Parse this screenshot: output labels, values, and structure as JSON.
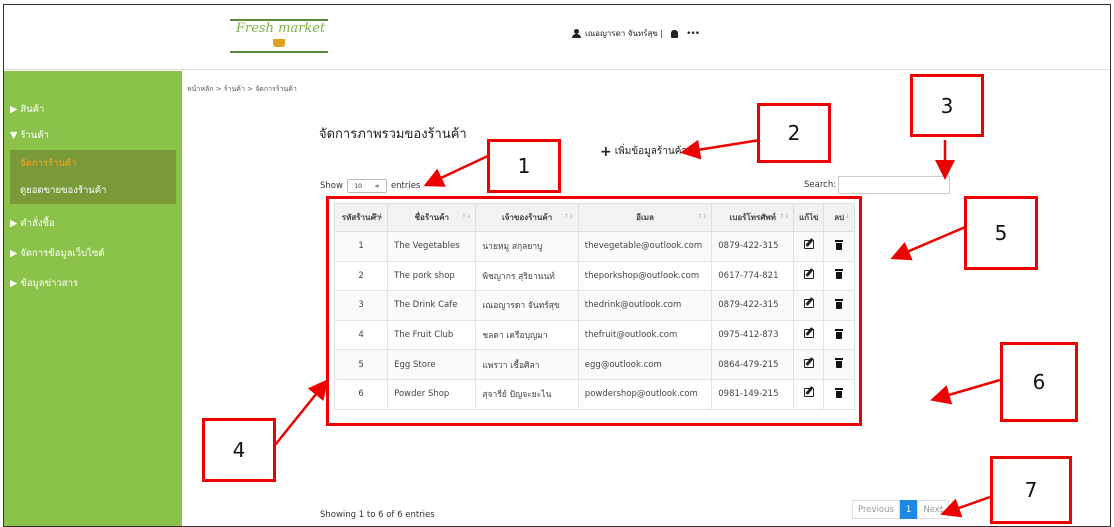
{
  "header": {
    "logo_text": "Fresh market",
    "user_name": "เณอญารดา จันทร์สุข |",
    "more": "•••"
  },
  "sidebar": {
    "items": [
      {
        "label": "▶ สินค้า"
      },
      {
        "label": "▼ ร้านค้า"
      },
      {
        "label": "จัดการร้านค้า"
      },
      {
        "label": "ดูยอดขายของร้านค้า"
      },
      {
        "label": "▶ คำสั่งซื้อ"
      },
      {
        "label": "▶ จัดการข้อมูลเว็บไซต์"
      },
      {
        "label": "▶ ข้อมูลข่าวสาร"
      }
    ]
  },
  "breadcrumb": "หน้าหลัก > ร้านค้า > จัดการร้านค้า",
  "page_title": "จัดการภาพรวมของร้านค้า",
  "add_button": {
    "plus": "+",
    "label": "เพิ่มข้อมูลร้านค้า"
  },
  "show": {
    "prefix": "Show",
    "value": "10",
    "arrows": "≑",
    "suffix": "entries"
  },
  "search": {
    "label": "Search:"
  },
  "table": {
    "headers": [
      "รหัสร้านค้า",
      "ชื่อร้านค้า",
      "เจ้าของร้านค้า",
      "อีเมล",
      "เบอร์โทรศัพท์",
      "แก้ไข",
      "ลบ"
    ],
    "sort_asc": "↑↓",
    "rows": [
      {
        "id": "1",
        "name": "The Vegetables",
        "owner": "นายหมู สกุลยาบู",
        "email": "thevegetable@outlook.com",
        "phone": "0879-422-315"
      },
      {
        "id": "2",
        "name": "The pork shop",
        "owner": "พิชญากร สุริยานนท์",
        "email": "theporkshop@outlook.com",
        "phone": "0617-774-821"
      },
      {
        "id": "3",
        "name": "The Drink Cafe",
        "owner": "เณอญารดา จันทร์สุข",
        "email": "thedrink@outlook.com",
        "phone": "0879-422-315"
      },
      {
        "id": "4",
        "name": "The Fruit Club",
        "owner": "ชลดา เครือบุญมา",
        "email": "thefruit@outlook.com",
        "phone": "0975-412-873"
      },
      {
        "id": "5",
        "name": "Egg Store",
        "owner": "แพรวา เชื้อศิลา",
        "email": "egg@outlook.com",
        "phone": "0864-479-215"
      },
      {
        "id": "6",
        "name": "Powder Shop",
        "owner": "สุจารีย์ ปัญจะยะไน",
        "email": "powdershop@outlook.com",
        "phone": "0981-149-215"
      }
    ]
  },
  "footer": {
    "showing": "Showing 1 to 6 of 6 entries",
    "prev": "Previous",
    "page": "1",
    "next": "Next"
  },
  "annotations": [
    "1",
    "2",
    "3",
    "4",
    "5",
    "6",
    "7"
  ],
  "colors": {
    "sidebar": "#8bc34a",
    "active_item": "#f5a623",
    "annotation": "#ee0000",
    "page_active": "#1e88e5"
  }
}
